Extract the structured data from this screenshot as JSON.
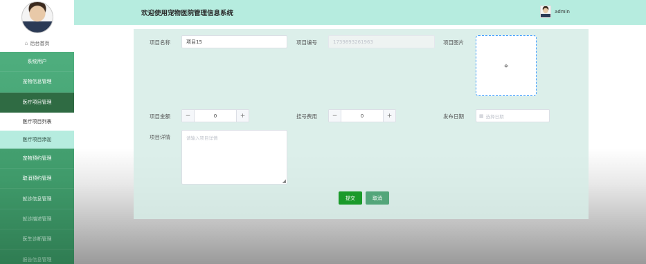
{
  "header": {
    "title": "欢迎使用宠物医院管理信息系统",
    "username": "admin"
  },
  "sidebar": {
    "home_label": "后台首页",
    "items": [
      {
        "label": "系统用户"
      },
      {
        "label": "宠物信息管理"
      },
      {
        "label": "医疗项目管理"
      },
      {
        "label": "医疗项目列表"
      },
      {
        "label": "医疗项目添加"
      },
      {
        "label": "宠物预约管理"
      },
      {
        "label": "取消预约管理"
      },
      {
        "label": "就诊信息管理"
      },
      {
        "label": "就诊描述管理"
      },
      {
        "label": "医生诊断管理"
      },
      {
        "label": "报告信息管理"
      }
    ]
  },
  "form": {
    "name_label": "项目名称",
    "name_value": "项目15",
    "code_label": "项目编号",
    "code_value": "1739893261963",
    "image_label": "项目图片",
    "amount_label": "项目金额",
    "amount_value": "0",
    "fee_label": "挂号费用",
    "fee_value": "0",
    "date_label": "发布日期",
    "date_placeholder": "选择日期",
    "detail_label": "项目详情",
    "detail_placeholder": "请输入项目详情",
    "submit_label": "提交",
    "cancel_label": "取消"
  },
  "icons": {
    "home": "home-icon",
    "calendar": "calendar-icon",
    "cursor": "move-cursor-icon"
  },
  "colors": {
    "sidebar_green": "#4aa878",
    "header_mint": "#b6ecdf",
    "active_dark": "#2f6b43",
    "submit_green": "#1a9a2a",
    "upload_border": "#409eff"
  }
}
